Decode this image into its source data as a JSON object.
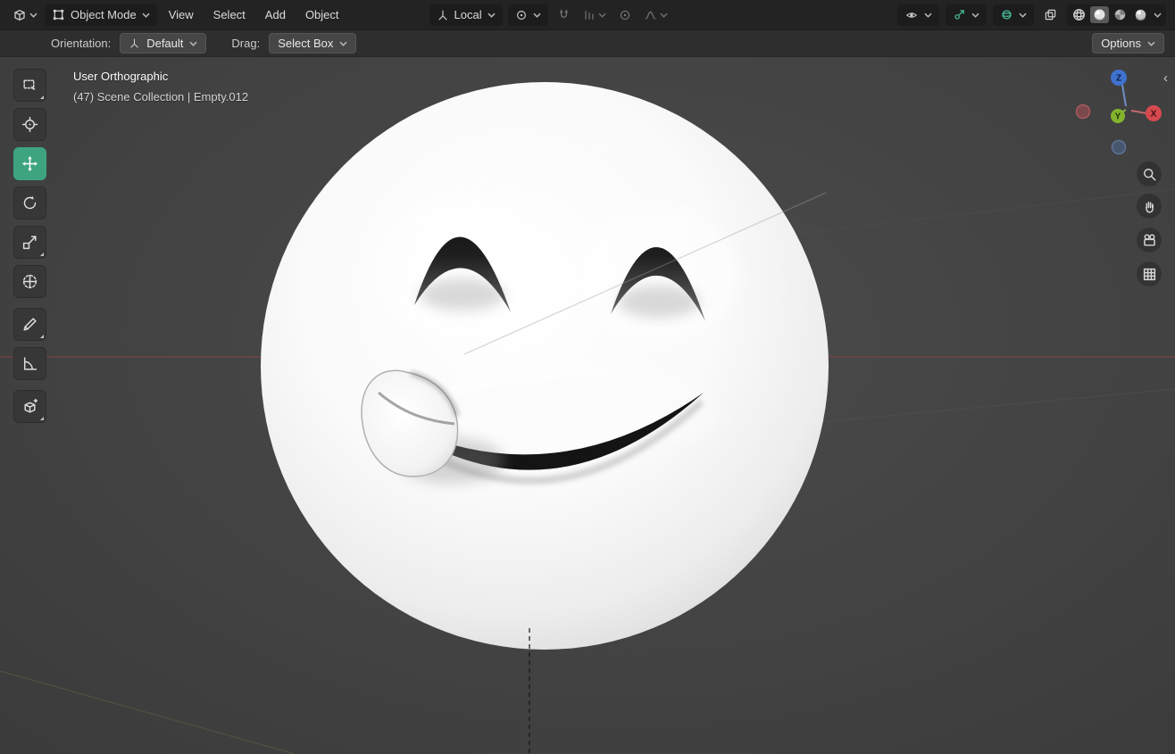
{
  "colors": {
    "accent": "#3da47f",
    "header_bg": "#232323",
    "toolrow_bg": "#2e2e2e",
    "viewport_bg": "#424242",
    "icon_teal": "#49c2a1",
    "axis_x": "#d6494f",
    "axis_y": "#84b32e",
    "axis_z": "#3f72cf"
  },
  "header": {
    "mode": "Object Mode",
    "menus": [
      "View",
      "Select",
      "Add",
      "Object"
    ],
    "orientation": "Local"
  },
  "tool_settings": {
    "orientation_label": "Orientation:",
    "orientation_value": "Default",
    "drag_label": "Drag:",
    "drag_value": "Select Box",
    "options_label": "Options"
  },
  "viewport": {
    "view_name": "User Orthographic",
    "breadcrumb": "(47) Scene Collection | Empty.012"
  },
  "gizmo": {
    "x": "X",
    "y": "Y",
    "z": "Z"
  },
  "state": {
    "active_tool": "move",
    "active_shading": "solid",
    "snap_enabled": false,
    "proportional_editing_enabled": false
  },
  "icons": {
    "header_left": [
      "editor-type-icon",
      "object-mode-icon"
    ],
    "header_center": [
      "orientation-axes-icon",
      "pivot-point-icon",
      "magnet-icon",
      "snap-increment-icon",
      "proportional-circle-icon",
      "falloff-curve-icon"
    ],
    "header_right": [
      "eye-icon",
      "gizmos-icon",
      "overlays-icon",
      "xray-icon",
      "shading-wireframe-icon",
      "shading-solid-icon",
      "shading-material-icon",
      "shading-rendered-icon"
    ],
    "left_toolbar": [
      "select-box-icon",
      "cursor-icon",
      "move-icon",
      "rotate-icon",
      "scale-icon",
      "transform-icon",
      "annotate-icon",
      "measure-icon",
      "add-cube-icon"
    ],
    "nav_cluster": [
      "zoom-icon",
      "pan-hand-icon",
      "camera-view-icon",
      "grid-ortho-icon"
    ]
  }
}
